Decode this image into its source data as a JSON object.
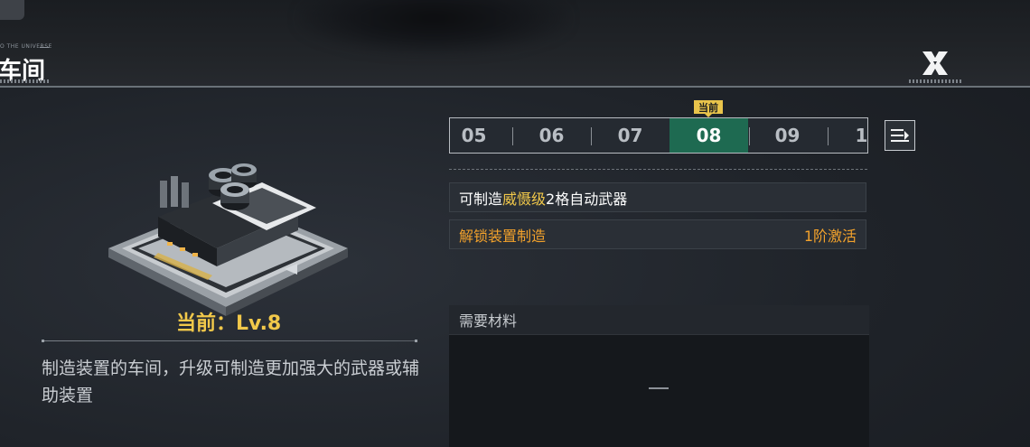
{
  "header": {
    "tag_text": "O THE UNIVERSE",
    "title": "车间",
    "close_label": "X"
  },
  "building": {
    "current_level_text": "当前：Lv.8",
    "description": "制造装置的车间，升级可制造更加强大的武器或辅助装置"
  },
  "level_selector": {
    "current_tag": "当前",
    "levels": [
      "05",
      "06",
      "07",
      "08",
      "09",
      "1"
    ],
    "active_level": "08"
  },
  "unlocks": {
    "row1_prefix": "可制造",
    "row1_highlight": "威慑级",
    "row1_suffix": "2格自动武器",
    "row2_label": "解锁装置制造",
    "row2_value": "1阶激活"
  },
  "materials": {
    "title": "需要材料"
  },
  "colors": {
    "accent_yellow": "#f1c84a",
    "accent_orange": "#f3a22b",
    "active_green": "#1e6a51"
  }
}
